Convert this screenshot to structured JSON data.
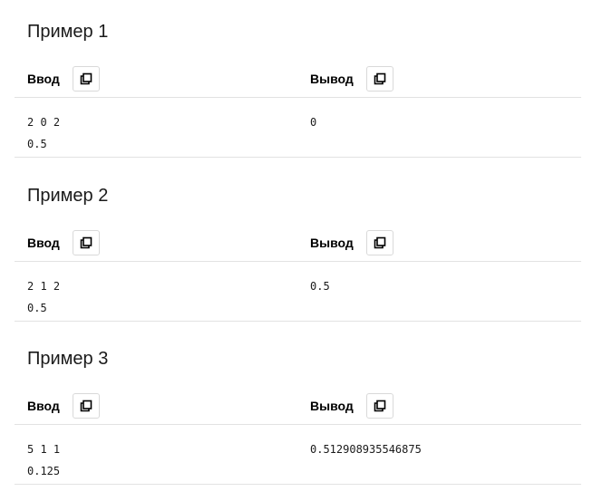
{
  "examples": [
    {
      "title": "Пример 1",
      "input_label": "Ввод",
      "output_label": "Вывод",
      "input_lines": [
        "2 0 2",
        "0.5"
      ],
      "output_lines": [
        "0"
      ]
    },
    {
      "title": "Пример 2",
      "input_label": "Ввод",
      "output_label": "Вывод",
      "input_lines": [
        "2 1 2",
        "0.5"
      ],
      "output_lines": [
        "0.5"
      ]
    },
    {
      "title": "Пример 3",
      "input_label": "Ввод",
      "output_label": "Вывод",
      "input_lines": [
        "5 1 1",
        "0.125"
      ],
      "output_lines": [
        "0.512908935546875"
      ]
    }
  ],
  "icons": {
    "copy": "copy-icon"
  }
}
